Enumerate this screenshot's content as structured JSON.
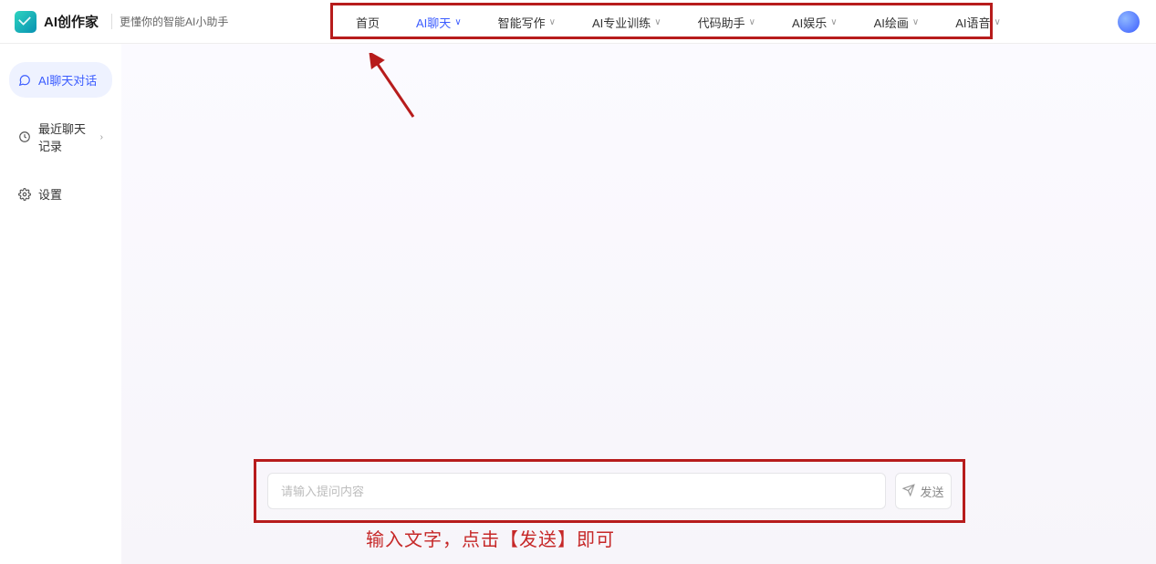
{
  "header": {
    "app_name": "AI创作家",
    "tagline": "更懂你的智能AI小助手"
  },
  "nav": {
    "items": [
      {
        "label": "首页",
        "dropdown": false,
        "active": false
      },
      {
        "label": "AI聊天",
        "dropdown": true,
        "active": true
      },
      {
        "label": "智能写作",
        "dropdown": true,
        "active": false
      },
      {
        "label": "AI专业训练",
        "dropdown": true,
        "active": false
      },
      {
        "label": "代码助手",
        "dropdown": true,
        "active": false
      },
      {
        "label": "AI娱乐",
        "dropdown": true,
        "active": false
      },
      {
        "label": "AI绘画",
        "dropdown": true,
        "active": false
      },
      {
        "label": "AI语音",
        "dropdown": true,
        "active": false
      }
    ]
  },
  "sidebar": {
    "items": [
      {
        "label": "AI聊天对话",
        "icon": "chat-icon",
        "active": true,
        "expandable": false
      },
      {
        "label": "最近聊天记录",
        "icon": "clock-icon",
        "active": false,
        "expandable": true
      },
      {
        "label": "设置",
        "icon": "gear-icon",
        "active": false,
        "expandable": false
      }
    ]
  },
  "chat": {
    "input_placeholder": "请输入提问内容",
    "send_label": "发送"
  },
  "annotations": {
    "hint_text": "输入文字，点击【发送】即可",
    "highlight_color": "#b71c1c"
  },
  "colors": {
    "accent": "#3b5cff"
  }
}
